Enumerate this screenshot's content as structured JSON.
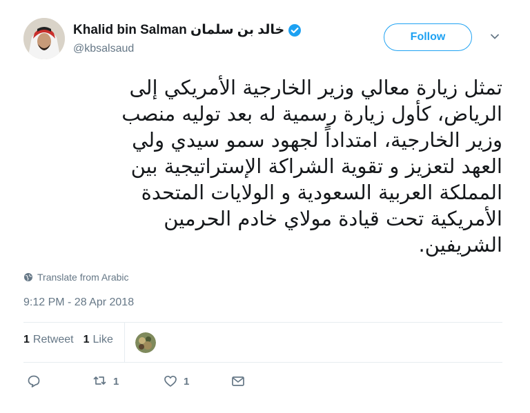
{
  "tweet": {
    "author_name": "Khalid bin Salman خالد بن سلمان",
    "handle": "@kbsalsaud",
    "verified_icon": "verified-badge-icon",
    "follow_label": "Follow",
    "text": "تمثل زيارة معالي وزير الخارجية الأمريكي إلى\nالرياض، كأول زيارة رسمية له بعد توليه منصب\nوزير الخارجية، امتداداً لجهود سمو سيدي ولي\nالعهد لتعزيز و تقوية الشراكة الإستراتيجية بين\nالمملكة العربية السعودية و الولايات المتحدة\nالأمريكية تحت قيادة مولاي خادم الحرمين\nالشريفين.",
    "translate_label": "Translate from Arabic",
    "timestamp": "9:12 PM - 28 Apr 2018"
  },
  "stats": {
    "retweets_count": "1",
    "retweets_label": "Retweet",
    "likes_count": "1",
    "likes_label": "Like"
  },
  "actions": {
    "reply_count": "",
    "retweet_count": "1",
    "like_count": "1"
  },
  "colors": {
    "accent": "#1da1f2",
    "muted": "#657786",
    "divider": "#e6ecf0"
  }
}
